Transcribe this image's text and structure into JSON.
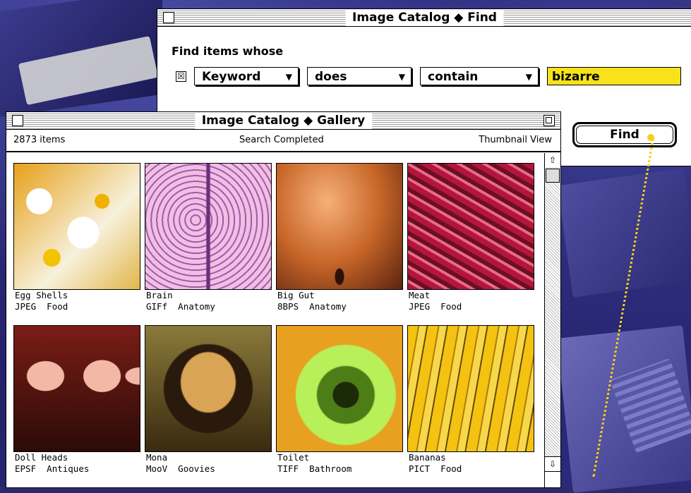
{
  "find_window": {
    "title": "Image Catalog ◆ Find",
    "heading": "Find items whose",
    "checkbox_mark": "☒",
    "field_popup": "Keyword",
    "operator_popup": "does",
    "relation_popup": "contain",
    "keyword_value": "bizarre",
    "find_button": "Find",
    "popup_arrow": "▼"
  },
  "gallery_window": {
    "title": "Image Catalog ◆ Gallery",
    "item_count": "2873 items",
    "status": "Search Completed",
    "view_mode": "Thumbnail View",
    "scroll_up": "⇧",
    "scroll_down": "⇩",
    "items": [
      {
        "name": "Egg Shells",
        "format": "JPEG",
        "category": "Food"
      },
      {
        "name": "Brain",
        "format": "GIFf",
        "category": "Anatomy"
      },
      {
        "name": "Big Gut",
        "format": "8BPS",
        "category": "Anatomy"
      },
      {
        "name": "Meat",
        "format": "JPEG",
        "category": "Food"
      },
      {
        "name": "Doll Heads",
        "format": "EPSF",
        "category": "Antiques"
      },
      {
        "name": "Mona",
        "format": "MooV",
        "category": "Goovies"
      },
      {
        "name": "Toilet",
        "format": "TIFF",
        "category": "Bathroom"
      },
      {
        "name": "Bananas",
        "format": "PICT",
        "category": "Food"
      }
    ]
  },
  "colors": {
    "keyword_highlight": "#f7e21b",
    "pointer_dot": "#f6cf18",
    "desktop": "#2c2a6e"
  },
  "icons": [
    "close-box-icon",
    "zoom-box-icon",
    "checkbox-icon",
    "popup-arrow-icon",
    "scroll-up-arrow-icon",
    "scroll-down-arrow-icon"
  ]
}
